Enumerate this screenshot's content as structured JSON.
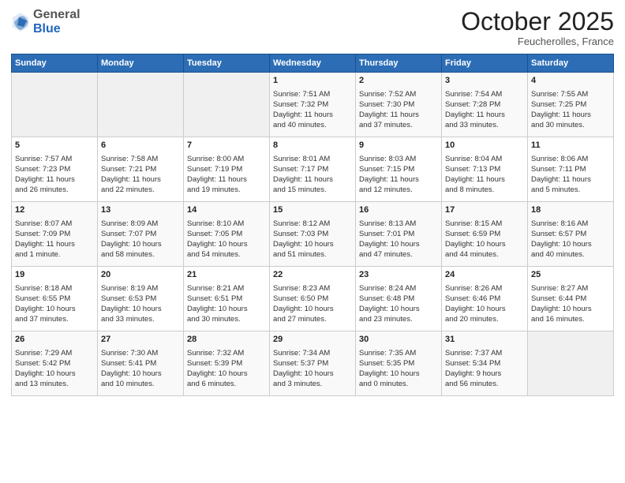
{
  "header": {
    "logo_general": "General",
    "logo_blue": "Blue",
    "month_title": "October 2025",
    "location": "Feucherolles, France"
  },
  "weekdays": [
    "Sunday",
    "Monday",
    "Tuesday",
    "Wednesday",
    "Thursday",
    "Friday",
    "Saturday"
  ],
  "weeks": [
    [
      {
        "day": "",
        "lines": []
      },
      {
        "day": "",
        "lines": []
      },
      {
        "day": "",
        "lines": []
      },
      {
        "day": "1",
        "lines": [
          "Sunrise: 7:51 AM",
          "Sunset: 7:32 PM",
          "Daylight: 11 hours",
          "and 40 minutes."
        ]
      },
      {
        "day": "2",
        "lines": [
          "Sunrise: 7:52 AM",
          "Sunset: 7:30 PM",
          "Daylight: 11 hours",
          "and 37 minutes."
        ]
      },
      {
        "day": "3",
        "lines": [
          "Sunrise: 7:54 AM",
          "Sunset: 7:28 PM",
          "Daylight: 11 hours",
          "and 33 minutes."
        ]
      },
      {
        "day": "4",
        "lines": [
          "Sunrise: 7:55 AM",
          "Sunset: 7:25 PM",
          "Daylight: 11 hours",
          "and 30 minutes."
        ]
      }
    ],
    [
      {
        "day": "5",
        "lines": [
          "Sunrise: 7:57 AM",
          "Sunset: 7:23 PM",
          "Daylight: 11 hours",
          "and 26 minutes."
        ]
      },
      {
        "day": "6",
        "lines": [
          "Sunrise: 7:58 AM",
          "Sunset: 7:21 PM",
          "Daylight: 11 hours",
          "and 22 minutes."
        ]
      },
      {
        "day": "7",
        "lines": [
          "Sunrise: 8:00 AM",
          "Sunset: 7:19 PM",
          "Daylight: 11 hours",
          "and 19 minutes."
        ]
      },
      {
        "day": "8",
        "lines": [
          "Sunrise: 8:01 AM",
          "Sunset: 7:17 PM",
          "Daylight: 11 hours",
          "and 15 minutes."
        ]
      },
      {
        "day": "9",
        "lines": [
          "Sunrise: 8:03 AM",
          "Sunset: 7:15 PM",
          "Daylight: 11 hours",
          "and 12 minutes."
        ]
      },
      {
        "day": "10",
        "lines": [
          "Sunrise: 8:04 AM",
          "Sunset: 7:13 PM",
          "Daylight: 11 hours",
          "and 8 minutes."
        ]
      },
      {
        "day": "11",
        "lines": [
          "Sunrise: 8:06 AM",
          "Sunset: 7:11 PM",
          "Daylight: 11 hours",
          "and 5 minutes."
        ]
      }
    ],
    [
      {
        "day": "12",
        "lines": [
          "Sunrise: 8:07 AM",
          "Sunset: 7:09 PM",
          "Daylight: 11 hours",
          "and 1 minute."
        ]
      },
      {
        "day": "13",
        "lines": [
          "Sunrise: 8:09 AM",
          "Sunset: 7:07 PM",
          "Daylight: 10 hours",
          "and 58 minutes."
        ]
      },
      {
        "day": "14",
        "lines": [
          "Sunrise: 8:10 AM",
          "Sunset: 7:05 PM",
          "Daylight: 10 hours",
          "and 54 minutes."
        ]
      },
      {
        "day": "15",
        "lines": [
          "Sunrise: 8:12 AM",
          "Sunset: 7:03 PM",
          "Daylight: 10 hours",
          "and 51 minutes."
        ]
      },
      {
        "day": "16",
        "lines": [
          "Sunrise: 8:13 AM",
          "Sunset: 7:01 PM",
          "Daylight: 10 hours",
          "and 47 minutes."
        ]
      },
      {
        "day": "17",
        "lines": [
          "Sunrise: 8:15 AM",
          "Sunset: 6:59 PM",
          "Daylight: 10 hours",
          "and 44 minutes."
        ]
      },
      {
        "day": "18",
        "lines": [
          "Sunrise: 8:16 AM",
          "Sunset: 6:57 PM",
          "Daylight: 10 hours",
          "and 40 minutes."
        ]
      }
    ],
    [
      {
        "day": "19",
        "lines": [
          "Sunrise: 8:18 AM",
          "Sunset: 6:55 PM",
          "Daylight: 10 hours",
          "and 37 minutes."
        ]
      },
      {
        "day": "20",
        "lines": [
          "Sunrise: 8:19 AM",
          "Sunset: 6:53 PM",
          "Daylight: 10 hours",
          "and 33 minutes."
        ]
      },
      {
        "day": "21",
        "lines": [
          "Sunrise: 8:21 AM",
          "Sunset: 6:51 PM",
          "Daylight: 10 hours",
          "and 30 minutes."
        ]
      },
      {
        "day": "22",
        "lines": [
          "Sunrise: 8:23 AM",
          "Sunset: 6:50 PM",
          "Daylight: 10 hours",
          "and 27 minutes."
        ]
      },
      {
        "day": "23",
        "lines": [
          "Sunrise: 8:24 AM",
          "Sunset: 6:48 PM",
          "Daylight: 10 hours",
          "and 23 minutes."
        ]
      },
      {
        "day": "24",
        "lines": [
          "Sunrise: 8:26 AM",
          "Sunset: 6:46 PM",
          "Daylight: 10 hours",
          "and 20 minutes."
        ]
      },
      {
        "day": "25",
        "lines": [
          "Sunrise: 8:27 AM",
          "Sunset: 6:44 PM",
          "Daylight: 10 hours",
          "and 16 minutes."
        ]
      }
    ],
    [
      {
        "day": "26",
        "lines": [
          "Sunrise: 7:29 AM",
          "Sunset: 5:42 PM",
          "Daylight: 10 hours",
          "and 13 minutes."
        ]
      },
      {
        "day": "27",
        "lines": [
          "Sunrise: 7:30 AM",
          "Sunset: 5:41 PM",
          "Daylight: 10 hours",
          "and 10 minutes."
        ]
      },
      {
        "day": "28",
        "lines": [
          "Sunrise: 7:32 AM",
          "Sunset: 5:39 PM",
          "Daylight: 10 hours",
          "and 6 minutes."
        ]
      },
      {
        "day": "29",
        "lines": [
          "Sunrise: 7:34 AM",
          "Sunset: 5:37 PM",
          "Daylight: 10 hours",
          "and 3 minutes."
        ]
      },
      {
        "day": "30",
        "lines": [
          "Sunrise: 7:35 AM",
          "Sunset: 5:35 PM",
          "Daylight: 10 hours",
          "and 0 minutes."
        ]
      },
      {
        "day": "31",
        "lines": [
          "Sunrise: 7:37 AM",
          "Sunset: 5:34 PM",
          "Daylight: 9 hours",
          "and 56 minutes."
        ]
      },
      {
        "day": "",
        "lines": []
      }
    ]
  ]
}
